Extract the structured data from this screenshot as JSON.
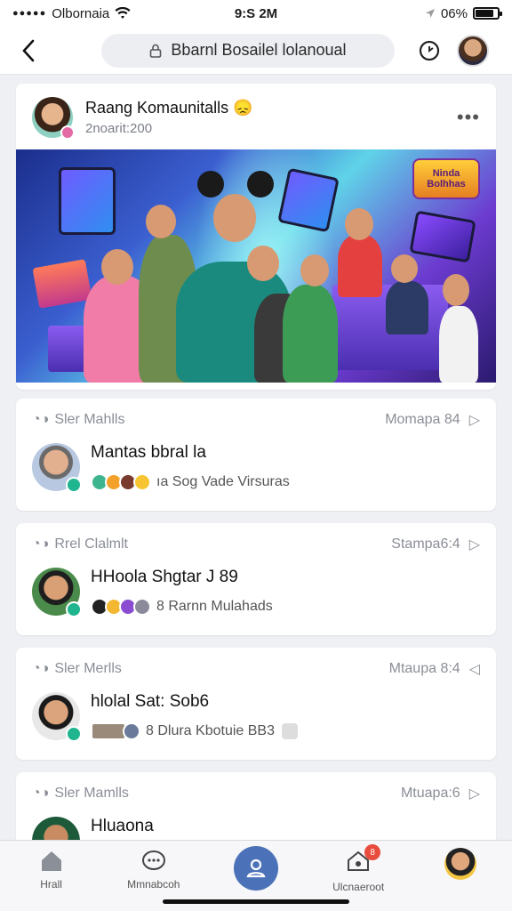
{
  "status_bar": {
    "carrier": "Olbornaia",
    "time": "9:S 2M",
    "battery_pct": "06%"
  },
  "nav": {
    "address": "Bbarnl Bosailel lolanoual"
  },
  "post": {
    "title": "Raang Komaunitalls",
    "emoji": "😞",
    "subtitle": "2noarit:200",
    "more": "•••",
    "hero_badge": "Ninda Bolhhas"
  },
  "notifications": [
    {
      "kind": "Sler Mahlls",
      "time": "Momapa 84",
      "title": "Mantas bbral la",
      "reaction_text": "ıa Sog Vade Virsuras"
    },
    {
      "kind": "Rrel Clalmlt",
      "time": "Stampa6:4",
      "title": "HHoola Shgtar J 89",
      "reaction_text": "8 Rarnn Mulahads"
    },
    {
      "kind": "Sler Merlls",
      "time": "Mtaupa 8:4",
      "title": "hlolal Sat: Sob6",
      "reaction_text": "8 Dlura Kbotuie BB3"
    },
    {
      "kind": "Sler Mamlls",
      "time": "Mtuapa:6",
      "title": "Hluaona",
      "reaction_text": ""
    }
  ],
  "tabs": {
    "home": "Hrall",
    "messages": "Mmnabcoh",
    "notifications": "Ulcnaeroot",
    "notif_badge": "8"
  },
  "colors": {
    "accent": "#4b71b8",
    "verified": "#1fb58f",
    "badge_red": "#e74c3c"
  }
}
